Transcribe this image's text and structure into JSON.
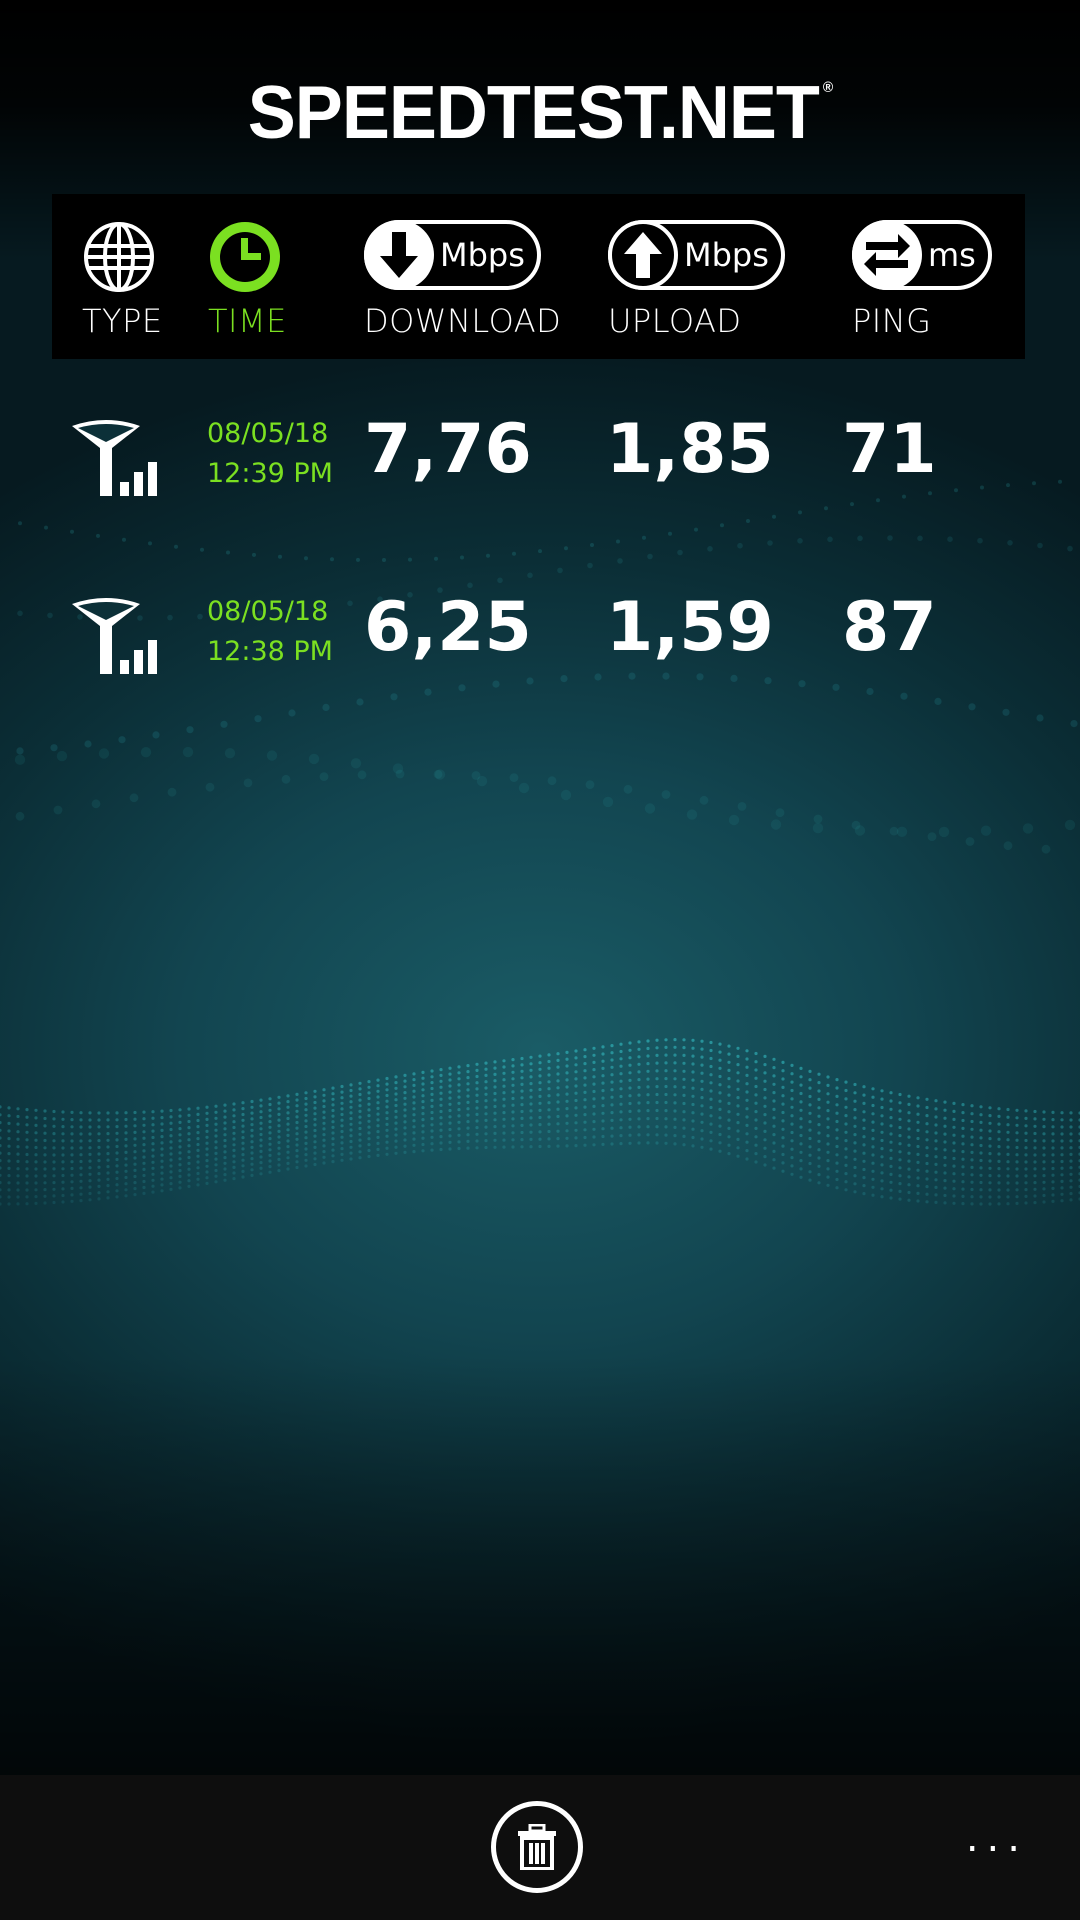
{
  "app": {
    "logo": "SPEEDTEST.NET",
    "trademark": "®"
  },
  "header": {
    "type": {
      "label": "TYPE",
      "icon": "globe-icon"
    },
    "time": {
      "label": "TIME",
      "icon": "clock-icon",
      "active": true
    },
    "download": {
      "label": "DOWNLOAD",
      "unit": "Mbps",
      "icon": "arrow-down-icon"
    },
    "upload": {
      "label": "UPLOAD",
      "unit": "Mbps",
      "icon": "arrow-up-icon"
    },
    "ping": {
      "label": "PING",
      "unit": "ms",
      "icon": "swap-arrows-icon"
    }
  },
  "results": [
    {
      "type_icon": "cellular-signal-icon",
      "date": "08/05/18",
      "time": "12:39 PM",
      "download": "7,76",
      "upload": "1,85",
      "ping": "71"
    },
    {
      "type_icon": "cellular-signal-icon",
      "date": "08/05/18",
      "time": "12:38 PM",
      "download": "6,25",
      "upload": "1,59",
      "ping": "87"
    }
  ],
  "appbar": {
    "delete_icon": "trash-icon",
    "more_label": "..."
  },
  "colors": {
    "accent": "#7be021",
    "background": "#0b2e36"
  }
}
